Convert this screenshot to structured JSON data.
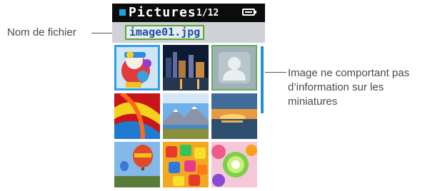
{
  "device": {
    "status_bar": {
      "title": "Pictures",
      "counter": "1/12",
      "title_square_color": "#1aa3e6",
      "battery": "battery-icon"
    },
    "filename": "image01.jpg",
    "thumbnails": [
      {
        "name": "thumb-clown-toy",
        "selected": true
      },
      {
        "name": "thumb-city-night",
        "selected": false
      },
      {
        "name": "thumb-no-preview",
        "selected": false,
        "placeholder": true,
        "icon": "person-silhouette-icon"
      },
      {
        "name": "thumb-red-feathers",
        "selected": false
      },
      {
        "name": "thumb-mountain-lake",
        "selected": false
      },
      {
        "name": "thumb-sunset-sea",
        "selected": false
      },
      {
        "name": "thumb-hot-air-balloons",
        "selected": false
      },
      {
        "name": "thumb-candy",
        "selected": false
      },
      {
        "name": "thumb-lollipops",
        "selected": false
      }
    ],
    "accent_color": "#1f8fd6",
    "highlight_color": "#5aa832"
  },
  "callouts": {
    "filename_label": "Nom de fichier",
    "no_thumbnail_label": "Image ne comportant pas d’information sur les miniatures"
  }
}
